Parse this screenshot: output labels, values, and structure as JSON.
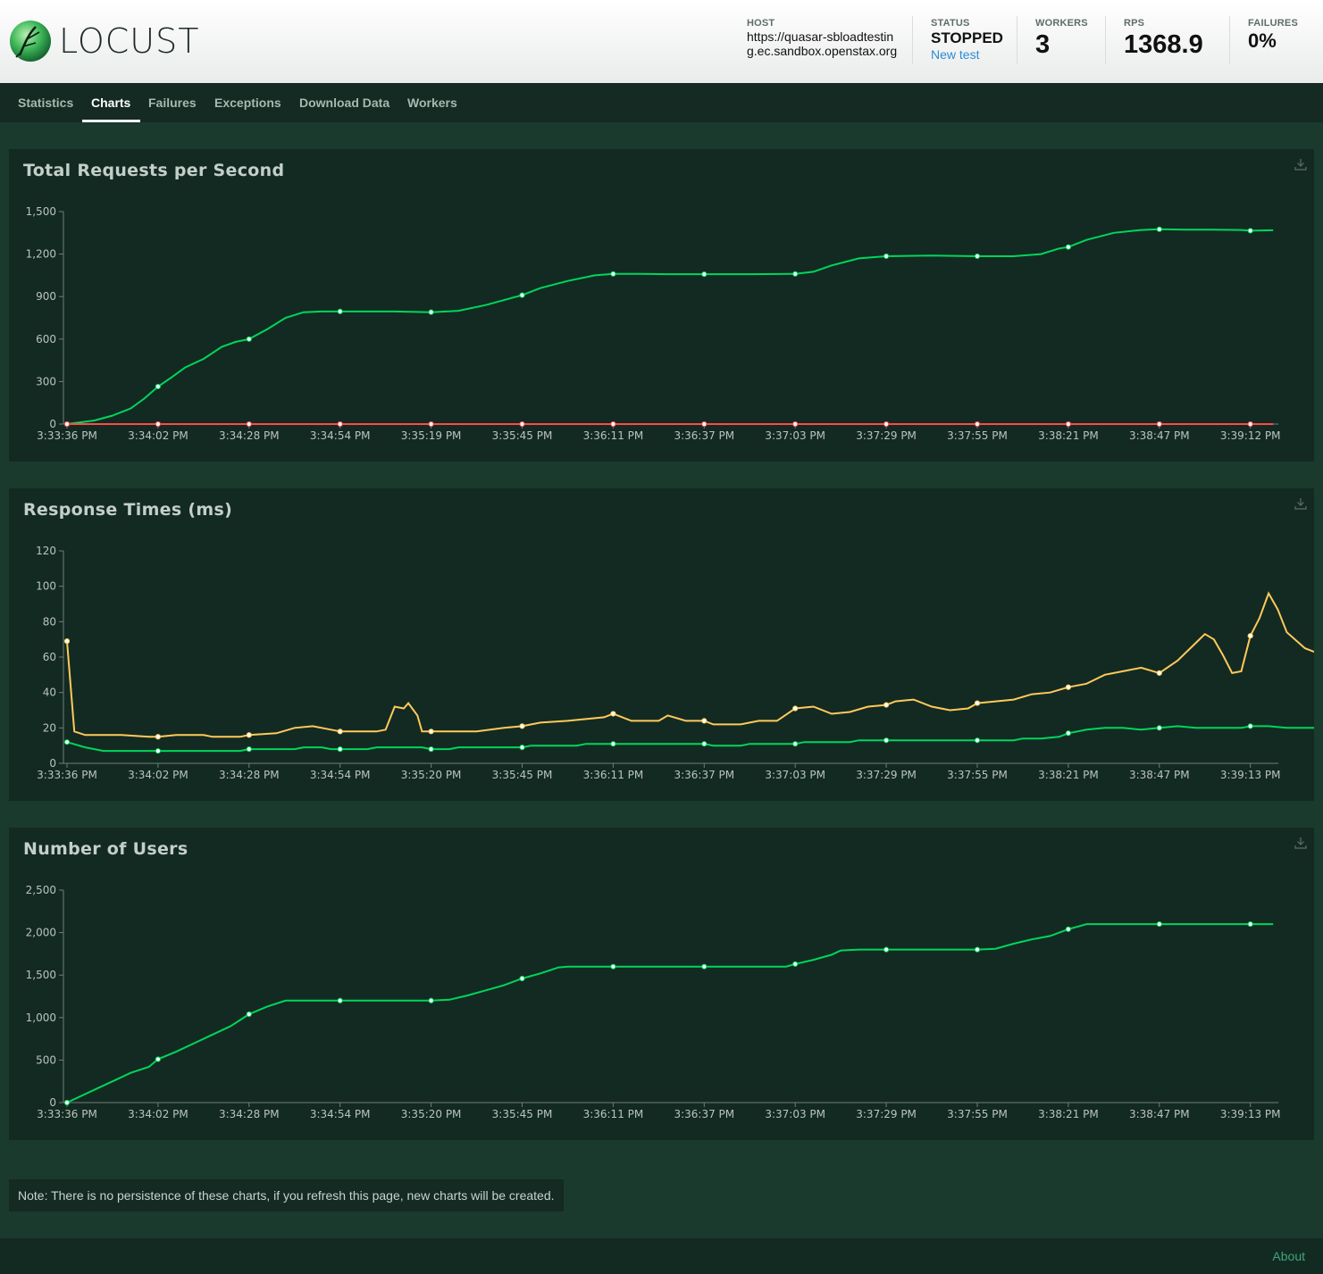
{
  "app": {
    "brand": "LOCUST"
  },
  "header": {
    "host_label": "HOST",
    "host_value": "https://quasar-sbloadtesting.ec.sandbox.openstax.org",
    "status_label": "STATUS",
    "status_value": "STOPPED",
    "new_test_link": "New test",
    "workers_label": "WORKERS",
    "workers_value": "3",
    "rps_label": "RPS",
    "rps_value": "1368.9",
    "failures_label": "FAILURES",
    "failures_value": "0%"
  },
  "tabs": [
    {
      "label": "Statistics",
      "active": false
    },
    {
      "label": "Charts",
      "active": true
    },
    {
      "label": "Failures",
      "active": false
    },
    {
      "label": "Exceptions",
      "active": false
    },
    {
      "label": "Download Data",
      "active": false
    },
    {
      "label": "Workers",
      "active": false
    }
  ],
  "colors": {
    "green": "#00d65b",
    "yellow": "#ffca5a",
    "red": "#ff4a4a",
    "accent_link": "#2e8bd6"
  },
  "icons": {
    "download": "download-icon",
    "logo": "locust-logo-icon"
  },
  "chart_data": [
    {
      "type": "line",
      "title": "Total Requests per Second",
      "yticks": [
        "0",
        "300",
        "600",
        "900",
        "1,200",
        "1,500"
      ],
      "ylim": [
        0,
        1500
      ],
      "xtick_labels": [
        "3:33:36 PM",
        "3:34:02 PM",
        "3:34:28 PM",
        "3:34:54 PM",
        "3:35:19 PM",
        "3:35:45 PM",
        "3:36:11 PM",
        "3:36:37 PM",
        "3:37:03 PM",
        "3:37:29 PM",
        "3:37:55 PM",
        "3:38:21 PM",
        "3:38:47 PM",
        "3:39:12 PM"
      ],
      "xmax_index": 13.25,
      "series": [
        {
          "color": "#00d65b",
          "points": [
            [
              0,
              0
            ],
            [
              0.3,
              25
            ],
            [
              0.5,
              60
            ],
            [
              0.7,
              110
            ],
            [
              0.85,
              180
            ],
            [
              1.0,
              265
            ],
            [
              1.15,
              330
            ],
            [
              1.3,
              400
            ],
            [
              1.5,
              460
            ],
            [
              1.7,
              545
            ],
            [
              1.85,
              580
            ],
            [
              2.0,
              600
            ],
            [
              2.2,
              670
            ],
            [
              2.4,
              750
            ],
            [
              2.6,
              790
            ],
            [
              2.8,
              795
            ],
            [
              3.0,
              795
            ],
            [
              3.3,
              795
            ],
            [
              3.6,
              795
            ],
            [
              4.0,
              790
            ],
            [
              4.3,
              800
            ],
            [
              4.6,
              840
            ],
            [
              5.0,
              910
            ],
            [
              5.2,
              960
            ],
            [
              5.5,
              1010
            ],
            [
              5.8,
              1050
            ],
            [
              6.0,
              1060
            ],
            [
              6.3,
              1060
            ],
            [
              6.6,
              1058
            ],
            [
              7.0,
              1058
            ],
            [
              7.5,
              1058
            ],
            [
              8.0,
              1060
            ],
            [
              8.2,
              1075
            ],
            [
              8.4,
              1120
            ],
            [
              8.7,
              1170
            ],
            [
              9.0,
              1185
            ],
            [
              9.5,
              1190
            ],
            [
              10.0,
              1185
            ],
            [
              10.4,
              1185
            ],
            [
              10.7,
              1200
            ],
            [
              10.9,
              1240
            ],
            [
              11.0,
              1250
            ],
            [
              11.2,
              1300
            ],
            [
              11.5,
              1350
            ],
            [
              11.8,
              1370
            ],
            [
              12.0,
              1375
            ],
            [
              12.3,
              1372
            ],
            [
              12.6,
              1372
            ],
            [
              12.9,
              1370
            ],
            [
              13.0,
              1365
            ],
            [
              13.25,
              1368
            ]
          ]
        },
        {
          "color": "#ff4a4a",
          "points": [
            [
              0,
              0
            ],
            [
              13.25,
              0
            ]
          ]
        }
      ]
    },
    {
      "type": "line",
      "title": "Response Times (ms)",
      "yticks": [
        "0",
        "20",
        "40",
        "60",
        "80",
        "100",
        "120"
      ],
      "ylim": [
        0,
        120
      ],
      "xtick_labels": [
        "3:33:36 PM",
        "3:34:02 PM",
        "3:34:28 PM",
        "3:34:54 PM",
        "3:35:20 PM",
        "3:35:45 PM",
        "3:36:11 PM",
        "3:36:37 PM",
        "3:37:03 PM",
        "3:37:29 PM",
        "3:37:55 PM",
        "3:38:21 PM",
        "3:38:47 PM",
        "3:39:13 PM"
      ],
      "xmax_index": 13.25,
      "series": [
        {
          "color": "#ffca5a",
          "points": [
            [
              0,
              69
            ],
            [
              0.08,
              18
            ],
            [
              0.2,
              16
            ],
            [
              0.6,
              16
            ],
            [
              0.9,
              15
            ],
            [
              1.0,
              15
            ],
            [
              1.2,
              16
            ],
            [
              1.5,
              16
            ],
            [
              1.6,
              15
            ],
            [
              1.9,
              15
            ],
            [
              2.0,
              16
            ],
            [
              2.3,
              17
            ],
            [
              2.5,
              20
            ],
            [
              2.7,
              21
            ],
            [
              2.9,
              19
            ],
            [
              3.0,
              18
            ],
            [
              3.2,
              18
            ],
            [
              3.4,
              18
            ],
            [
              3.5,
              19
            ],
            [
              3.6,
              32
            ],
            [
              3.7,
              31
            ],
            [
              3.75,
              34
            ],
            [
              3.85,
              27
            ],
            [
              3.9,
              18
            ],
            [
              4.0,
              18
            ],
            [
              4.5,
              18
            ],
            [
              4.8,
              20
            ],
            [
              5.0,
              21
            ],
            [
              5.2,
              23
            ],
            [
              5.5,
              24
            ],
            [
              5.7,
              25
            ],
            [
              5.9,
              26
            ],
            [
              6.0,
              28
            ],
            [
              6.2,
              24
            ],
            [
              6.5,
              24
            ],
            [
              6.6,
              27
            ],
            [
              6.8,
              24
            ],
            [
              7.0,
              24
            ],
            [
              7.1,
              22
            ],
            [
              7.4,
              22
            ],
            [
              7.6,
              24
            ],
            [
              7.8,
              24
            ],
            [
              8.0,
              31
            ],
            [
              8.2,
              32
            ],
            [
              8.4,
              28
            ],
            [
              8.6,
              29
            ],
            [
              8.8,
              32
            ],
            [
              9.0,
              33
            ],
            [
              9.1,
              35
            ],
            [
              9.3,
              36
            ],
            [
              9.5,
              32
            ],
            [
              9.7,
              30
            ],
            [
              9.9,
              31
            ],
            [
              10.0,
              34
            ],
            [
              10.2,
              35
            ],
            [
              10.4,
              36
            ],
            [
              10.6,
              39
            ],
            [
              10.8,
              40
            ],
            [
              11.0,
              43
            ],
            [
              11.2,
              45
            ],
            [
              11.4,
              50
            ],
            [
              11.6,
              52
            ],
            [
              11.8,
              54
            ],
            [
              12.0,
              51
            ],
            [
              12.2,
              58
            ],
            [
              12.4,
              68
            ],
            [
              12.5,
              73
            ],
            [
              12.6,
              70
            ],
            [
              12.7,
              61
            ],
            [
              12.8,
              51
            ],
            [
              12.9,
              52
            ],
            [
              13.0,
              72
            ],
            [
              13.1,
              82
            ],
            [
              13.2,
              96
            ],
            [
              13.3,
              87
            ],
            [
              13.4,
              74
            ],
            [
              13.6,
              65
            ],
            [
              13.7,
              63
            ]
          ]
        },
        {
          "color": "#00d65b",
          "points": [
            [
              0,
              12
            ],
            [
              0.2,
              9
            ],
            [
              0.4,
              7
            ],
            [
              0.6,
              7
            ],
            [
              1.0,
              7
            ],
            [
              1.5,
              7
            ],
            [
              1.9,
              7
            ],
            [
              2.0,
              8
            ],
            [
              2.5,
              8
            ],
            [
              2.6,
              9
            ],
            [
              2.8,
              9
            ],
            [
              2.9,
              8
            ],
            [
              3.0,
              8
            ],
            [
              3.3,
              8
            ],
            [
              3.4,
              9
            ],
            [
              3.9,
              9
            ],
            [
              4.0,
              8
            ],
            [
              4.2,
              8
            ],
            [
              4.3,
              9
            ],
            [
              5.0,
              9
            ],
            [
              5.1,
              10
            ],
            [
              5.6,
              10
            ],
            [
              5.7,
              11
            ],
            [
              6.0,
              11
            ],
            [
              7.0,
              11
            ],
            [
              7.1,
              10
            ],
            [
              7.4,
              10
            ],
            [
              7.5,
              11
            ],
            [
              8.0,
              11
            ],
            [
              8.1,
              12
            ],
            [
              8.6,
              12
            ],
            [
              8.7,
              13
            ],
            [
              9.0,
              13
            ],
            [
              10.0,
              13
            ],
            [
              10.4,
              13
            ],
            [
              10.5,
              14
            ],
            [
              10.7,
              14
            ],
            [
              10.9,
              15
            ],
            [
              11.0,
              17
            ],
            [
              11.2,
              19
            ],
            [
              11.4,
              20
            ],
            [
              11.6,
              20
            ],
            [
              11.8,
              19
            ],
            [
              12.0,
              20
            ],
            [
              12.2,
              21
            ],
            [
              12.4,
              20
            ],
            [
              12.6,
              20
            ],
            [
              12.9,
              20
            ],
            [
              13.0,
              21
            ],
            [
              13.2,
              21
            ],
            [
              13.4,
              20
            ],
            [
              13.7,
              20
            ]
          ]
        }
      ]
    },
    {
      "type": "line",
      "title": "Number of Users",
      "yticks": [
        "0",
        "500",
        "1,000",
        "1,500",
        "2,000",
        "2,500"
      ],
      "ylim": [
        0,
        2500
      ],
      "xtick_labels": [
        "3:33:36 PM",
        "3:34:02 PM",
        "3:34:28 PM",
        "3:34:54 PM",
        "3:35:20 PM",
        "3:35:45 PM",
        "3:36:11 PM",
        "3:36:37 PM",
        "3:37:03 PM",
        "3:37:29 PM",
        "3:37:55 PM",
        "3:38:21 PM",
        "3:38:47 PM",
        "3:39:13 PM"
      ],
      "xmax_index": 13.25,
      "series": [
        {
          "color": "#00d65b",
          "points": [
            [
              0,
              0
            ],
            [
              0.3,
              150
            ],
            [
              0.5,
              250
            ],
            [
              0.7,
              350
            ],
            [
              0.9,
              420
            ],
            [
              1.0,
              510
            ],
            [
              1.2,
              600
            ],
            [
              1.4,
              700
            ],
            [
              1.6,
              800
            ],
            [
              1.8,
              900
            ],
            [
              2.0,
              1040
            ],
            [
              2.2,
              1130
            ],
            [
              2.4,
              1200
            ],
            [
              2.6,
              1200
            ],
            [
              3.0,
              1200
            ],
            [
              3.5,
              1200
            ],
            [
              4.0,
              1200
            ],
            [
              4.2,
              1210
            ],
            [
              4.4,
              1260
            ],
            [
              4.6,
              1320
            ],
            [
              4.8,
              1380
            ],
            [
              5.0,
              1460
            ],
            [
              5.2,
              1520
            ],
            [
              5.4,
              1590
            ],
            [
              5.5,
              1600
            ],
            [
              6.0,
              1600
            ],
            [
              6.5,
              1600
            ],
            [
              7.0,
              1600
            ],
            [
              7.5,
              1600
            ],
            [
              7.9,
              1600
            ],
            [
              8.0,
              1630
            ],
            [
              8.2,
              1680
            ],
            [
              8.4,
              1740
            ],
            [
              8.5,
              1790
            ],
            [
              8.7,
              1800
            ],
            [
              9.0,
              1800
            ],
            [
              9.5,
              1800
            ],
            [
              10.0,
              1800
            ],
            [
              10.2,
              1810
            ],
            [
              10.4,
              1870
            ],
            [
              10.6,
              1920
            ],
            [
              10.8,
              1960
            ],
            [
              11.0,
              2040
            ],
            [
              11.2,
              2100
            ],
            [
              11.5,
              2100
            ],
            [
              12.0,
              2100
            ],
            [
              12.5,
              2100
            ],
            [
              13.0,
              2100
            ],
            [
              13.25,
              2100
            ]
          ]
        }
      ]
    }
  ],
  "note": "Note: There is no persistence of these charts, if you refresh this page, new charts will be created.",
  "footer": {
    "about": "About"
  }
}
